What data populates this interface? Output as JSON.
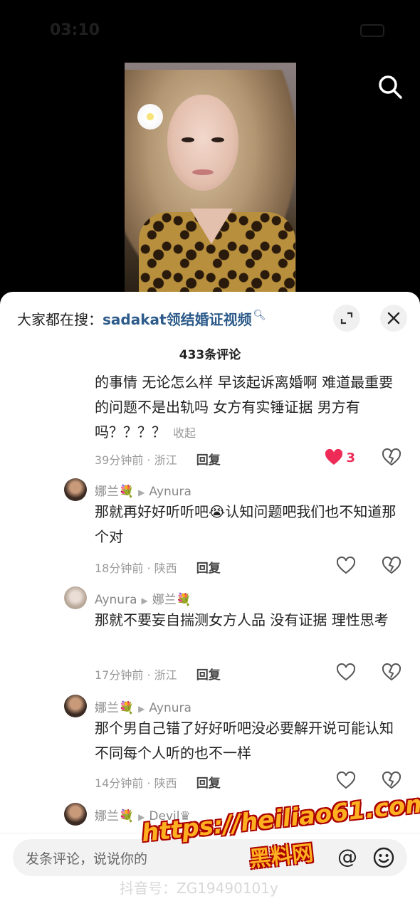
{
  "status": {
    "time": "03:10"
  },
  "header": {
    "search_prefix": "大家都在搜：",
    "search_term": "sadakat领结婚证视频",
    "comment_count": "433条评论"
  },
  "top_comment": {
    "text": "的事情 无论怎么样 早该起诉离婚啊 难道最重要的问题不是出轨吗 女方有实锤证据 男方有吗？？？？",
    "collapse_label": "收起",
    "meta": "39分钟前 · 浙江",
    "reply_label": "回复",
    "like_count": "3"
  },
  "replies": [
    {
      "author": "娜兰💐",
      "to": "Aynura",
      "text_a": "那就再好好听听吧",
      "emoji": "😭",
      "text_b": "认知问题吧我们也不知道那个对",
      "meta": "18分钟前 · 陕西",
      "reply_label": "回复"
    },
    {
      "author": "Aynura",
      "to": "娜兰💐",
      "text": "那就不要妄自揣测女方人品 没有证据 理性思考",
      "meta": "17分钟前 · 浙江",
      "reply_label": "回复"
    },
    {
      "author": "娜兰💐",
      "to": "Aynura",
      "text": "那个男自己错了好好听吧没必要解开说可能认知不同每个人听的也不一样",
      "meta": "14分钟前 · 陕西",
      "reply_label": "回复"
    },
    {
      "author": "娜兰💐",
      "to": "Devil♛"
    }
  ],
  "input": {
    "placeholder": "发条评论，说说你的"
  },
  "watermark": {
    "line1": "https://heiliao61.com",
    "line2": "黑料网"
  },
  "footer": {
    "douyin_id": "抖音号：ZG19490101y"
  },
  "colors": {
    "accent_like": "#ee2a56",
    "search_term": "#2d5b8a",
    "watermark": "#ffb020"
  }
}
